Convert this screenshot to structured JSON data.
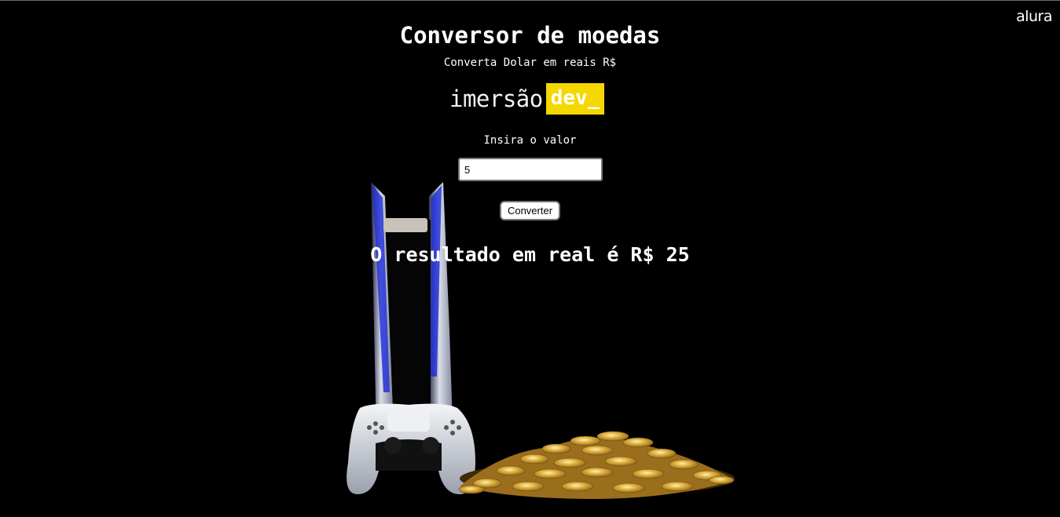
{
  "branding": {
    "alura": "alura",
    "imersao_word": "imersão",
    "dev_word": "dev_"
  },
  "header": {
    "title": "Conversor de moedas",
    "subtitle": "Converta Dolar em reais R$"
  },
  "form": {
    "label": "Insira o valor",
    "input_value": "5",
    "button_label": "Converter"
  },
  "result": {
    "text": "O resultado em real é R$ 25"
  },
  "background": {
    "description_icons": [
      "console-icon",
      "controller-icon",
      "gold-coins-icon"
    ]
  },
  "colors": {
    "background": "#000000",
    "accent": "#f5d800",
    "text": "#ffffff"
  }
}
